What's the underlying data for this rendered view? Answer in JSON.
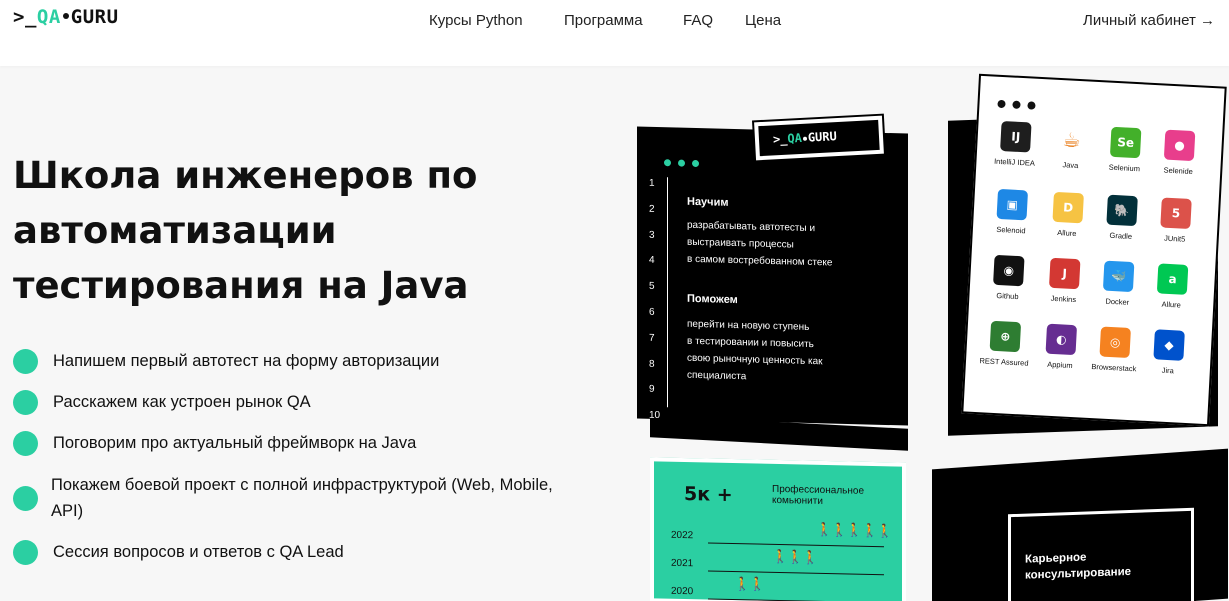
{
  "header": {
    "logo_prefix": ">_",
    "logo_qa": "QA",
    "logo_guru": "GURU",
    "nav": [
      "Курсы Python",
      "Программа",
      "FAQ",
      "Цена"
    ],
    "account": "Личный кабинет →"
  },
  "hero": {
    "title_lines": [
      "Школа инженеров по",
      "автоматизации",
      "тестирования на Java"
    ],
    "bullets": [
      "Напишем первый автотест на форму авторизации",
      "Расскажем как устроен рынок QA",
      "Поговорим про актуальный фреймворк на Java",
      "Покажем боевой проект с полной инфраструктурой (Web, Mobile, API)",
      "Сессия вопросов и ответов с QA Lead"
    ]
  },
  "code_card": {
    "logo_prefix": ">_",
    "logo_qa": "QA",
    "logo_guru": "GURU",
    "line_numbers": [
      "1",
      "2",
      "3",
      "4",
      "5",
      "6",
      "7",
      "8",
      "9",
      "10"
    ],
    "heading1": "Научим",
    "text1": [
      "разрабатывать автотесты и",
      "выстраивать процессы",
      "в самом востребованном стеке"
    ],
    "heading2": "Поможем",
    "text2": [
      "перейти на новую ступень",
      "в тестировании и повысить",
      "свою рыночную ценность как",
      "специалиста"
    ]
  },
  "tools": [
    {
      "label": "IntelliJ IDEA",
      "icon": "intellij-icon",
      "glyph": "IJ",
      "color": "#1e1e1e"
    },
    {
      "label": "Java",
      "icon": "java-icon",
      "glyph": "☕",
      "color": "#ffffff"
    },
    {
      "label": "Selenium",
      "icon": "selenium-icon",
      "glyph": "Se",
      "color": "#43b02a"
    },
    {
      "label": "Selenide",
      "icon": "selenide-icon",
      "glyph": "●",
      "color": "#e83e8c"
    },
    {
      "label": "Selenoid",
      "icon": "selenoid-icon",
      "glyph": "▣",
      "color": "#1e88e5"
    },
    {
      "label": "Allure",
      "icon": "allure-icon",
      "glyph": "D",
      "color": "#f6c343"
    },
    {
      "label": "Gradle",
      "icon": "gradle-icon",
      "glyph": "🐘",
      "color": "#02303a"
    },
    {
      "label": "JUnit5",
      "icon": "junit5-icon",
      "glyph": "5",
      "color": "#dc524a"
    },
    {
      "label": "Github",
      "icon": "github-icon",
      "glyph": "◉",
      "color": "#111111"
    },
    {
      "label": "Jenkins",
      "icon": "jenkins-icon",
      "glyph": "J",
      "color": "#d33833"
    },
    {
      "label": "Docker",
      "icon": "docker-icon",
      "glyph": "🐳",
      "color": "#2496ed"
    },
    {
      "label": "Allure",
      "icon": "allure-ring-icon",
      "glyph": "a",
      "color": "#00c853"
    },
    {
      "label": "REST Assured",
      "icon": "rest-assured-icon",
      "glyph": "⊕",
      "color": "#2e7d32"
    },
    {
      "label": "Appium",
      "icon": "appium-icon",
      "glyph": "◐",
      "color": "#662d91"
    },
    {
      "label": "Browserstack",
      "icon": "browserstack-icon",
      "glyph": "◎",
      "color": "#f58220"
    },
    {
      "label": "Jira",
      "icon": "jira-icon",
      "glyph": "◆",
      "color": "#0052cc"
    }
  ],
  "green_card": {
    "big": "5к +",
    "sub": "Профессиональное комьюнити",
    "years": [
      "2022",
      "2021",
      "2020"
    ]
  },
  "career_card": {
    "text_lines": [
      "Карьерное",
      "консультирование"
    ]
  },
  "colors": {
    "accent": "#2bcfa2",
    "dark": "#000000"
  }
}
